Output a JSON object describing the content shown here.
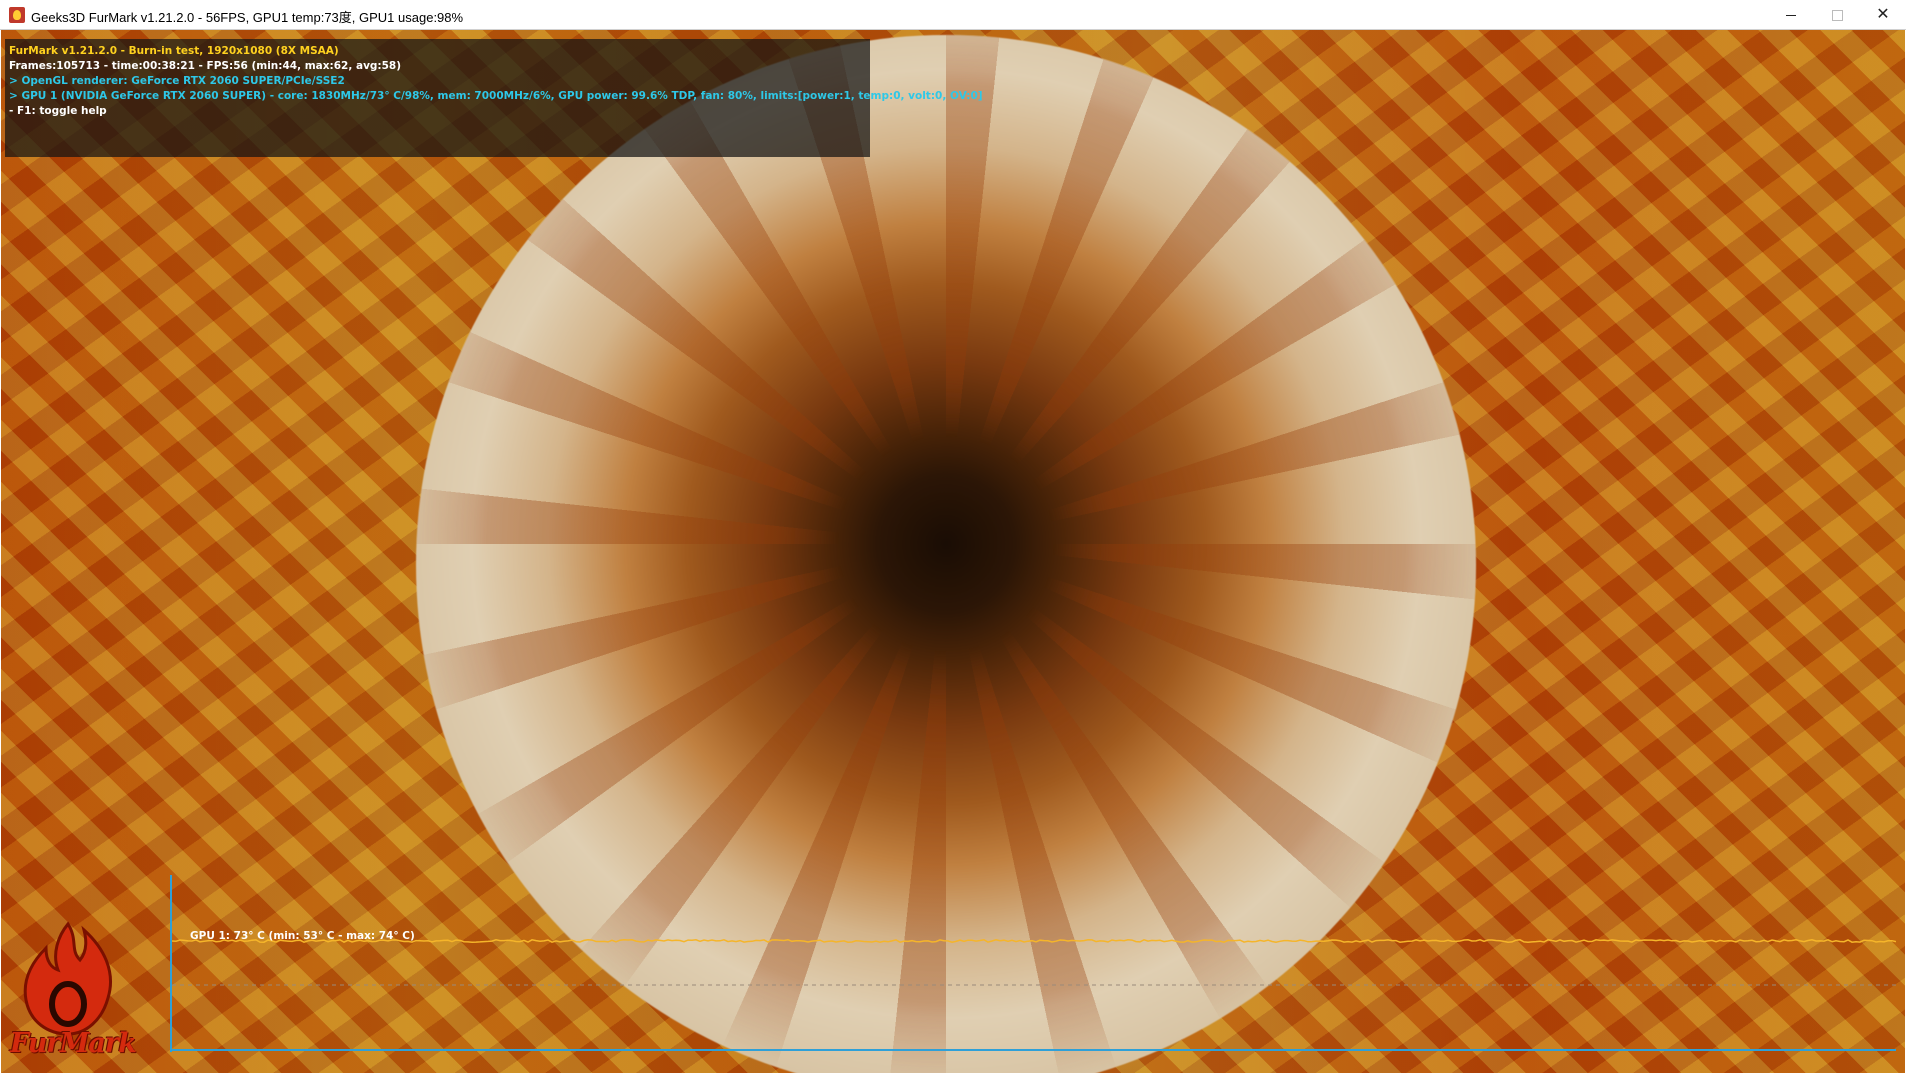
{
  "window": {
    "title": "Geeks3D FurMark v1.21.2.0 - 56FPS, GPU1 temp:73度, GPU1 usage:98%",
    "icon": "furmark-app-icon",
    "controls": {
      "minimize_icon": "minimize-icon",
      "maximize_icon": "maximize-icon",
      "close_icon": "close-icon",
      "close_glyph": "✕"
    }
  },
  "osd": {
    "lines": [
      "FurMark v1.21.2.0 - Burn-in test, 1920x1080 (8X MSAA)",
      "Frames:105713 - time:00:38:21 - FPS:56 (min:44, max:62, avg:58)",
      "> OpenGL renderer: GeForce RTX 2060 SUPER/PCIe/SSE2",
      "> GPU 1 (NVIDIA GeForce RTX 2060 SUPER) - core: 1830MHz/73° C/98%, mem: 7000MHz/6%, GPU power: 99.6% TDP, fan: 80%, limits:[power:1, temp:0, volt:0, OV:0]",
      "- F1: toggle help"
    ],
    "colors": {
      "title": "#ffd21f",
      "stats": "#ffffff",
      "gpu": "#2ec8e8",
      "help": "#ffffff"
    }
  },
  "graph": {
    "label": "GPU 1: 73° C (min: 53° C - max: 74° C)",
    "current_temp_c": 73,
    "min_temp_c": 53,
    "max_temp_c": 74,
    "line_color": "#f5b52a",
    "axis_color": "#2ea0d8"
  },
  "logo": {
    "text": "FurMark",
    "icon": "furmark-flame-logo"
  },
  "colors": {
    "background_orange": "#e0620a",
    "fur_light": "#e0cfb2",
    "fur_dark": "#2c1606"
  }
}
